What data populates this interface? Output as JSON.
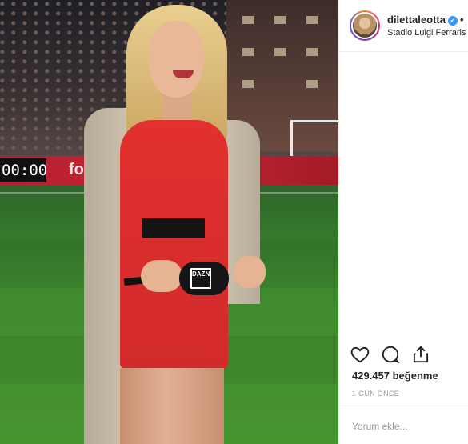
{
  "post": {
    "username": "dilettaleotta",
    "verified_mark": "✓",
    "separator": "•",
    "location": "Stadio Luigi Ferraris",
    "likes_text": "429.457 beğenme",
    "time_text": "1 GÜN ÖNCE",
    "comment_placeholder": "Yorum ekle..."
  },
  "photo": {
    "scoreboard_text": "00:00",
    "board_text": "fo",
    "mic_flag_text": "DAZN"
  },
  "icons": {
    "like": "heart-icon",
    "comment": "comment-bubble-icon",
    "share": "share-icon"
  },
  "colors": {
    "verified_blue": "#3897f0",
    "dress_red": "#d22a2a",
    "border": "#efefef"
  }
}
